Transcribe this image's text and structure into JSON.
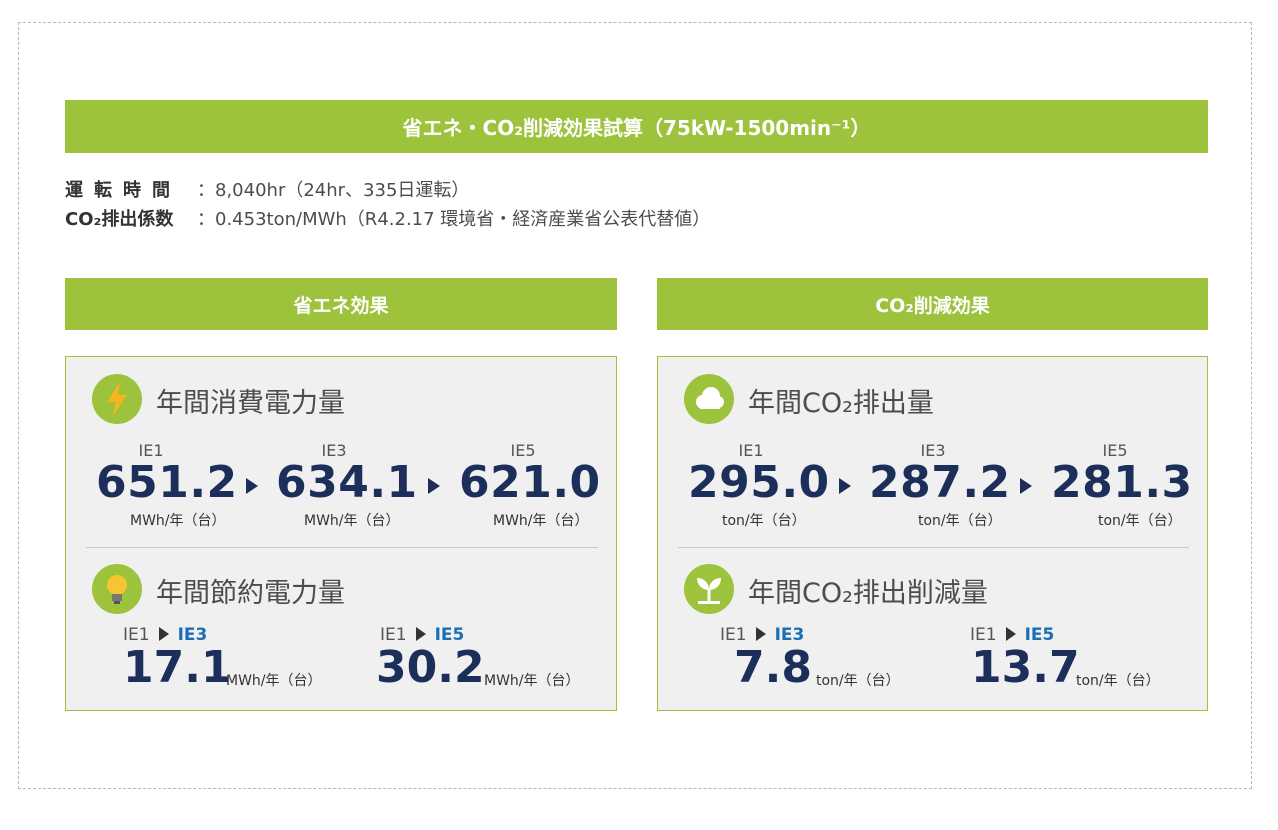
{
  "title": "省エネ・CO₂削減効果試算（75kW-1500min⁻¹）",
  "info": {
    "rows": [
      {
        "label": "運転時間",
        "value": "：8,040hr（24hr、335日運転）"
      },
      {
        "label": "CO₂排出係数",
        "value": "：0.453ton/MWh（R4.2.17 環境省・経済産業省公表代替値）"
      }
    ]
  },
  "energy": {
    "header": "省エネ効果",
    "annual": {
      "title": "年間消費電力量",
      "icon": "lightning-icon",
      "items": [
        {
          "level": "IE1",
          "value": "651.2",
          "unit": "MWh/年（台）"
        },
        {
          "level": "IE3",
          "value": "634.1",
          "unit": "MWh/年（台）"
        },
        {
          "level": "IE5",
          "value": "621.0",
          "unit": "MWh/年（台）"
        }
      ]
    },
    "savings": {
      "title": "年間節約電力量",
      "icon": "lightbulb-icon",
      "items": [
        {
          "from": "IE1",
          "to": "IE3",
          "value": "17.1",
          "unit": "MWh/年（台）"
        },
        {
          "from": "IE1",
          "to": "IE5",
          "value": "30.2",
          "unit": "MWh/年（台）"
        }
      ]
    }
  },
  "co2": {
    "header": "CO₂削減効果",
    "annual": {
      "title": "年間CO₂排出量",
      "icon": "cloud-icon",
      "items": [
        {
          "level": "IE1",
          "value": "295.0",
          "unit": "ton/年（台）"
        },
        {
          "level": "IE3",
          "value": "287.2",
          "unit": "ton/年（台）"
        },
        {
          "level": "IE5",
          "value": "281.3",
          "unit": "ton/年（台）"
        }
      ]
    },
    "savings": {
      "title": "年間CO₂排出削減量",
      "icon": "sprout-icon",
      "items": [
        {
          "from": "IE1",
          "to": "IE3",
          "value": "7.8",
          "unit": "ton/年（台）"
        },
        {
          "from": "IE1",
          "to": "IE5",
          "value": "13.7",
          "unit": "ton/年（台）"
        }
      ]
    }
  },
  "colors": {
    "accent": "#9dc23b",
    "number": "#1c2f5a",
    "highlight": "#1a6eb5"
  }
}
